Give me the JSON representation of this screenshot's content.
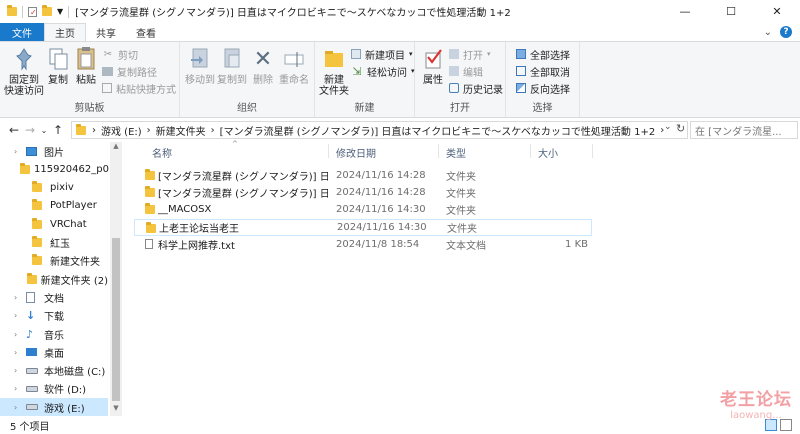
{
  "window": {
    "title": "[マンダラ流星群 (シグノマンダラ)] 日直はマイクロビキニで～スケベなカッコで性処理活動 1+2",
    "controls": {
      "minimize": "—",
      "maximize": "☐",
      "close": "✕"
    }
  },
  "ribbon_tabs": [
    "文件",
    "主页",
    "共享",
    "查看"
  ],
  "ribbon": {
    "clipboard": {
      "label": "剪贴板",
      "pin": "固定到\n快速访问",
      "copy": "复制",
      "paste": "粘贴",
      "cut": "剪切",
      "copy_path": "复制路径",
      "paste_shortcut": "粘贴快捷方式"
    },
    "organize": {
      "label": "组织",
      "move_to": "移动到",
      "copy_to": "复制到",
      "delete": "删除",
      "rename": "重命名"
    },
    "new": {
      "label": "新建",
      "new_folder": "新建\n文件夹",
      "new_item": "新建项目",
      "easy_access": "轻松访问"
    },
    "open": {
      "label": "打开",
      "properties": "属性",
      "open": "打开",
      "edit": "编辑",
      "history": "历史记录"
    },
    "select": {
      "label": "选择",
      "select_all": "全部选择",
      "select_none": "全部取消",
      "invert": "反向选择"
    }
  },
  "address": {
    "segments": [
      "游戏 (E:)",
      "新建文件夹",
      "[マンダラ流星群 (シグノマンダラ)] 日直はマイクロビキニで～スケベなカッコで性処理活動 1+2"
    ],
    "search_placeholder": "在 [マンダラ流星..."
  },
  "sidebar": [
    {
      "label": "图片",
      "icon": "pictures-icon",
      "indent": 0
    },
    {
      "label": "115920462_p0",
      "icon": "folder-icon",
      "indent": 1
    },
    {
      "label": "pixiv",
      "icon": "folder-icon",
      "indent": 1
    },
    {
      "label": "PotPlayer",
      "icon": "folder-icon",
      "indent": 1
    },
    {
      "label": "VRChat",
      "icon": "folder-icon",
      "indent": 1
    },
    {
      "label": "紅玉",
      "icon": "folder-icon",
      "indent": 1
    },
    {
      "label": "新建文件夹",
      "icon": "folder-icon",
      "indent": 1
    },
    {
      "label": "新建文件夹 (2)",
      "icon": "folder-icon",
      "indent": 1
    },
    {
      "label": "文档",
      "icon": "documents-icon",
      "indent": 0
    },
    {
      "label": "下载",
      "icon": "downloads-icon",
      "indent": 0
    },
    {
      "label": "音乐",
      "icon": "music-icon",
      "indent": 0
    },
    {
      "label": "桌面",
      "icon": "desktop-icon",
      "indent": 0
    },
    {
      "label": "本地磁盘 (C:)",
      "icon": "drive-icon",
      "indent": 0
    },
    {
      "label": "软件 (D:)",
      "icon": "drive-icon",
      "indent": 0
    },
    {
      "label": "游戏 (E:)",
      "icon": "drive-icon",
      "indent": 0,
      "selected": true
    }
  ],
  "columns": {
    "name": "名称",
    "modified": "修改日期",
    "type": "类型",
    "size": "大小"
  },
  "files": [
    {
      "name": "[マンダラ流星群 (シグノマンダラ)] 日直...",
      "modified": "2024/11/16 14:28",
      "type": "文件夹",
      "size": "",
      "kind": "folder"
    },
    {
      "name": "[マンダラ流星群 (シグノマンダラ)] 日直...",
      "modified": "2024/11/16 14:28",
      "type": "文件夹",
      "size": "",
      "kind": "folder"
    },
    {
      "name": "__MACOSX",
      "modified": "2024/11/16 14:30",
      "type": "文件夹",
      "size": "",
      "kind": "folder"
    },
    {
      "name": "上老王论坛当老王",
      "modified": "2024/11/16 14:30",
      "type": "文件夹",
      "size": "",
      "kind": "folder",
      "hover": true
    },
    {
      "name": "科学上网推荐.txt",
      "modified": "2024/11/8 18:54",
      "type": "文本文档",
      "size": "1 KB",
      "kind": "text"
    }
  ],
  "status": {
    "count": "5 个项目"
  },
  "watermark": {
    "line1": "老王论坛",
    "line2": "laowang..."
  }
}
